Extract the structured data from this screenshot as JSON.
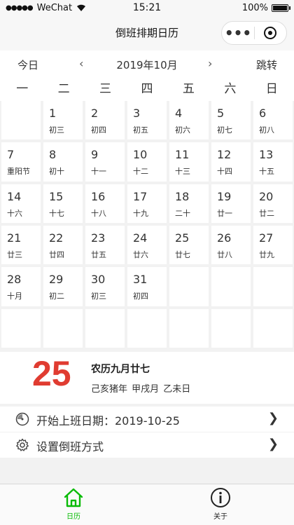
{
  "status": {
    "signal": "●●●●●",
    "carrier": "WeChat",
    "time": "15:21",
    "battery": "100%"
  },
  "nav": {
    "title": "倒班排期日历",
    "more": "•••"
  },
  "header": {
    "today": "今日",
    "prev": "‹",
    "month": "2019年10月",
    "next": "›",
    "jump": "跳转"
  },
  "weekdays": [
    "一",
    "二",
    "三",
    "四",
    "五",
    "六",
    "日"
  ],
  "calendar": {
    "cells": [
      {
        "num": "",
        "lunar": ""
      },
      {
        "num": "1",
        "lunar": "初三"
      },
      {
        "num": "2",
        "lunar": "初四"
      },
      {
        "num": "3",
        "lunar": "初五"
      },
      {
        "num": "4",
        "lunar": "初六"
      },
      {
        "num": "5",
        "lunar": "初七"
      },
      {
        "num": "6",
        "lunar": "初八"
      },
      {
        "num": "7",
        "lunar": "重阳节"
      },
      {
        "num": "8",
        "lunar": "初十"
      },
      {
        "num": "9",
        "lunar": "十一"
      },
      {
        "num": "10",
        "lunar": "十二"
      },
      {
        "num": "11",
        "lunar": "十三"
      },
      {
        "num": "12",
        "lunar": "十四"
      },
      {
        "num": "13",
        "lunar": "十五"
      },
      {
        "num": "14",
        "lunar": "十六"
      },
      {
        "num": "15",
        "lunar": "十七"
      },
      {
        "num": "16",
        "lunar": "十八"
      },
      {
        "num": "17",
        "lunar": "十九"
      },
      {
        "num": "18",
        "lunar": "二十"
      },
      {
        "num": "19",
        "lunar": "廿一"
      },
      {
        "num": "20",
        "lunar": "廿二"
      },
      {
        "num": "21",
        "lunar": "廿三"
      },
      {
        "num": "22",
        "lunar": "廿四"
      },
      {
        "num": "23",
        "lunar": "廿五"
      },
      {
        "num": "24",
        "lunar": "廿六"
      },
      {
        "num": "25",
        "lunar": "廿七"
      },
      {
        "num": "26",
        "lunar": "廿八"
      },
      {
        "num": "27",
        "lunar": "廿九"
      },
      {
        "num": "28",
        "lunar": "十月"
      },
      {
        "num": "29",
        "lunar": "初二"
      },
      {
        "num": "30",
        "lunar": "初三"
      },
      {
        "num": "31",
        "lunar": "初四"
      },
      {
        "num": "",
        "lunar": ""
      },
      {
        "num": "",
        "lunar": ""
      },
      {
        "num": "",
        "lunar": ""
      },
      {
        "num": "",
        "lunar": ""
      },
      {
        "num": "",
        "lunar": ""
      },
      {
        "num": "",
        "lunar": ""
      },
      {
        "num": "",
        "lunar": ""
      },
      {
        "num": "",
        "lunar": ""
      },
      {
        "num": "",
        "lunar": ""
      },
      {
        "num": "",
        "lunar": ""
      }
    ]
  },
  "selected": {
    "day": "25",
    "lunar": "农历九月廿七",
    "ganzhi": "己亥猪年  甲戌月  乙未日"
  },
  "rows": {
    "start_label": "开始上班日期：2019-10-25",
    "setting_label": "设置倒班方式",
    "arrow": "❯"
  },
  "tabs": {
    "calendar": "日历",
    "about": "关于"
  },
  "colors": {
    "accent": "#09bb07",
    "highlight": "#e03c31"
  }
}
